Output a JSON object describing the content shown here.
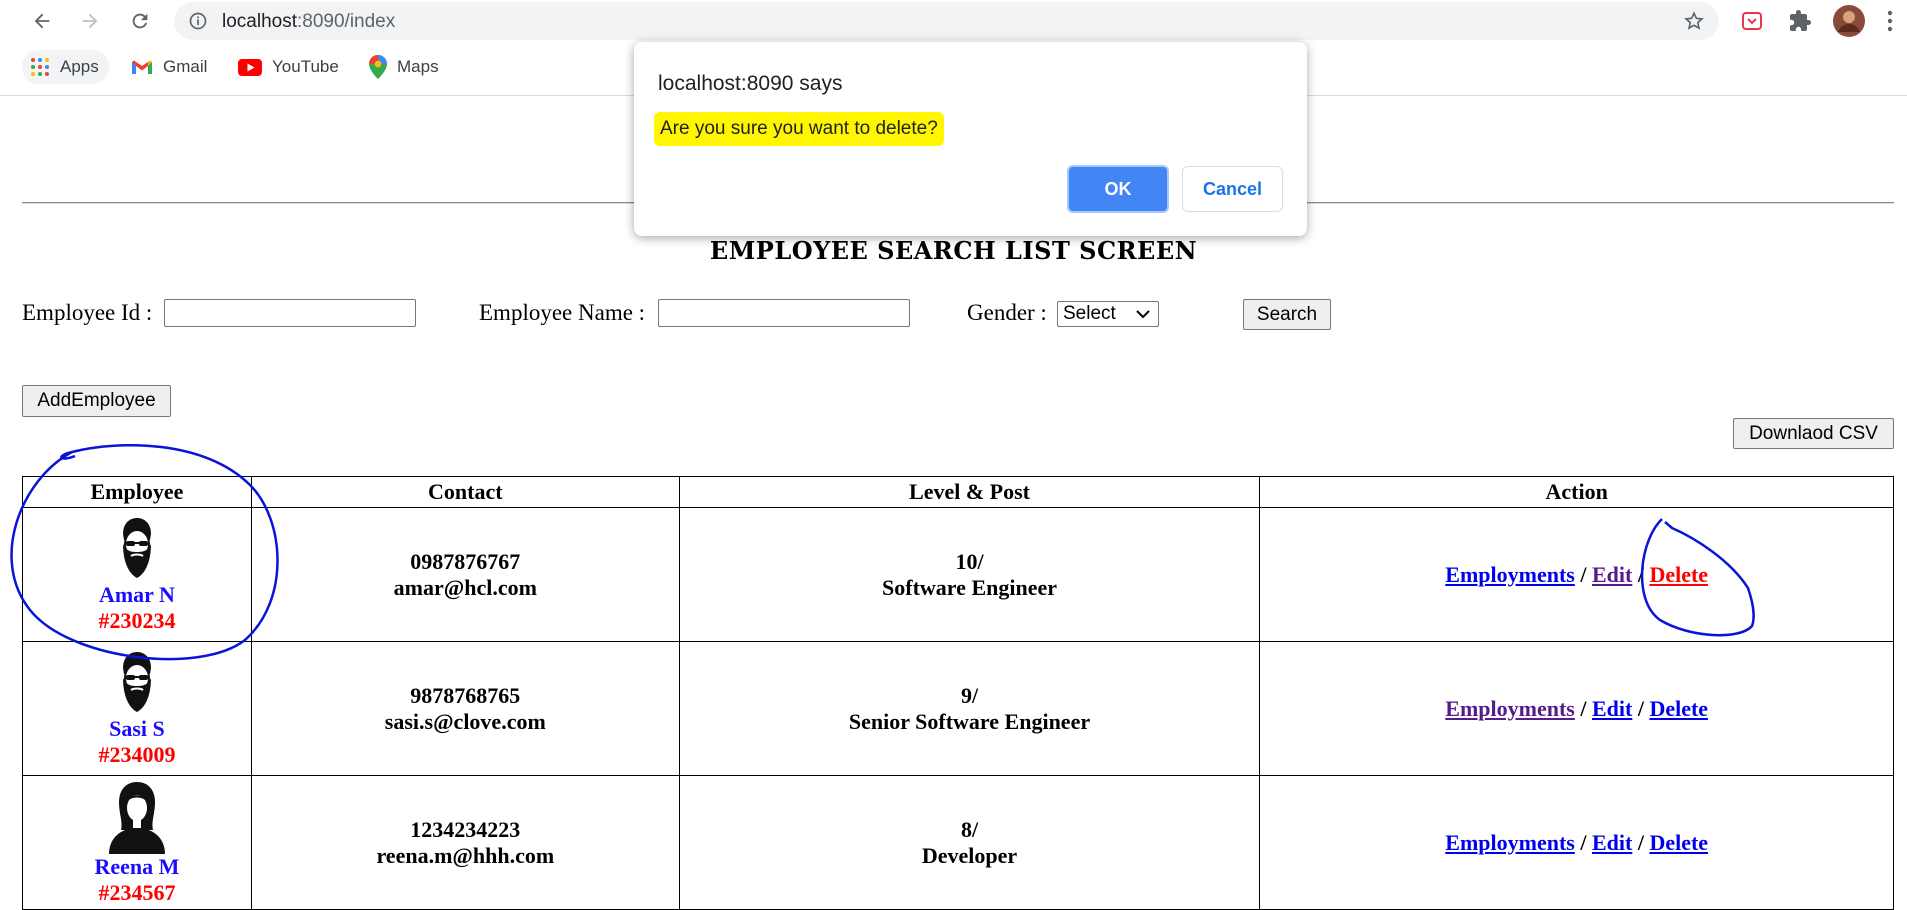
{
  "browser": {
    "url_host": "localhost",
    "url_path": ":8090/index",
    "bookmarks": [
      {
        "label": "Apps",
        "icon": "apps-grid-icon"
      },
      {
        "label": "Gmail",
        "icon": "gmail-icon"
      },
      {
        "label": "YouTube",
        "icon": "youtube-icon"
      },
      {
        "label": "Maps",
        "icon": "maps-icon"
      }
    ]
  },
  "page": {
    "title": "EMPLOYEE SEARCH LIST SCREEN",
    "form": {
      "employee_id_label": "Employee Id :",
      "employee_name_label": "Employee Name :",
      "gender_label": "Gender :",
      "gender_selected": "Select",
      "search_button": "Search"
    },
    "add_employee_button": "AddEmployee",
    "download_csv_button": "Downlaod CSV",
    "table": {
      "headers": [
        "Employee",
        "Contact",
        "Level & Post",
        "Action"
      ],
      "rows": [
        {
          "name": "Amar N",
          "id": "#230234",
          "phone": "0987876767",
          "email": "amar@hcl.com",
          "level": "10/",
          "post": "Software Engineer"
        },
        {
          "name": "Sasi S",
          "id": "#234009",
          "phone": "9878768765",
          "email": "sasi.s@clove.com",
          "level": "9/",
          "post": "Senior Software Engineer"
        },
        {
          "name": "Reena M",
          "id": "#234567",
          "phone": "1234234223",
          "email": "reena.m@hhh.com",
          "level": "8/",
          "post": "Developer"
        }
      ],
      "actions": {
        "employments": "Employments",
        "edit": "Edit",
        "delete": "Delete",
        "separator": "/"
      }
    }
  },
  "dialog": {
    "title": "localhost:8090 says",
    "message": "Are you sure you want to delete?",
    "ok": "OK",
    "cancel": "Cancel"
  },
  "colors": {
    "highlight": "#fff600",
    "annotation": "#0a14d8",
    "dialog_ok": "#4285f4",
    "employee_name": "#1a0dff",
    "employee_id": "#ff0000"
  }
}
